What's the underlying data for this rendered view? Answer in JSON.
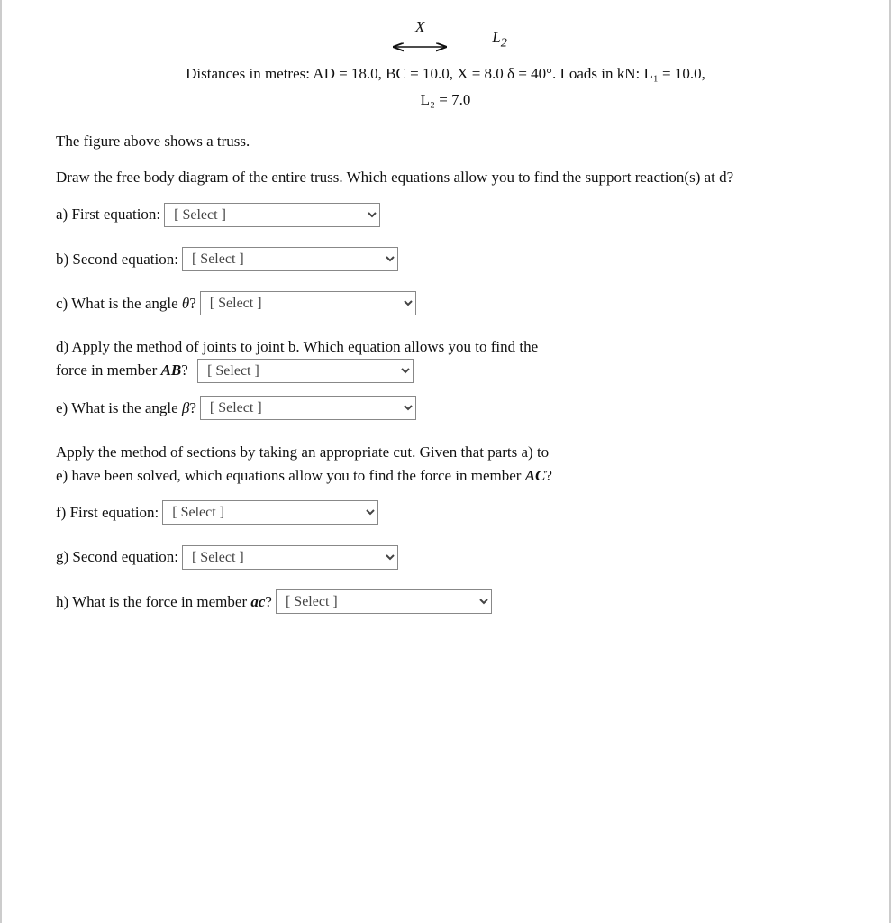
{
  "diagram": {
    "x_label": "X",
    "l2_label": "L₂"
  },
  "distances": {
    "line1": "Distances in metres: AD = 18.0, BC = 10.0, X = 8.0  δ = 40°. Loads in kN: L₁ = 10.0,",
    "line2": "L₂ = 7.0"
  },
  "description1": "The figure above shows a truss.",
  "description2": "Draw the free body diagram of the entire truss. Which equations allow you to find the support reaction(s) at d?",
  "questions": [
    {
      "id": "a",
      "label": "a) First equation:",
      "placeholder": "[ Select ]"
    },
    {
      "id": "b",
      "label": "b) Second equation:",
      "placeholder": "[ Select ]"
    },
    {
      "id": "c",
      "label": "c) What is the angle θ?",
      "placeholder": "[ Select ]"
    }
  ],
  "description3_line1": "d) Apply the method of joints to joint b. Which equation allows you to find the",
  "description3_line2": "force in member AB?",
  "question_d_placeholder": "[ Select ]",
  "question_e": {
    "label": "e) What is the angle β?",
    "placeholder": "[ Select ]"
  },
  "description4_line1": "Apply the method of sections by taking an appropriate cut. Given that parts a) to",
  "description4_line2": "e) have been solved, which equations allow you to find the force in member AC?",
  "questions2": [
    {
      "id": "f",
      "label": "f) First equation:",
      "placeholder": "[ Select ]"
    },
    {
      "id": "g",
      "label": "g) Second equation:",
      "placeholder": "[ Select ]"
    }
  ],
  "question_h": {
    "label": "h) What is the force in member ac?",
    "placeholder": "[ Select ]"
  }
}
